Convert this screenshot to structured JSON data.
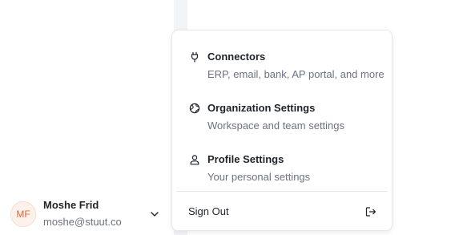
{
  "user": {
    "initials": "MF",
    "name": "Moshe Frid",
    "email": "moshe@stuut.co",
    "avatar_color": "#e36a3c",
    "menu_toggle_icon": "chevron-down-icon"
  },
  "menu": {
    "items": [
      {
        "title": "Connectors",
        "description": "ERP, email, bank, AP portal, and more",
        "icon": "plug-icon"
      },
      {
        "title": "Organization Settings",
        "description": "Workspace and team settings",
        "icon": "globe-icon"
      },
      {
        "title": "Profile Settings",
        "description": "Your personal settings",
        "icon": "user-icon"
      }
    ],
    "sign_out": {
      "label": "Sign Out",
      "icon": "sign-out-icon"
    }
  }
}
